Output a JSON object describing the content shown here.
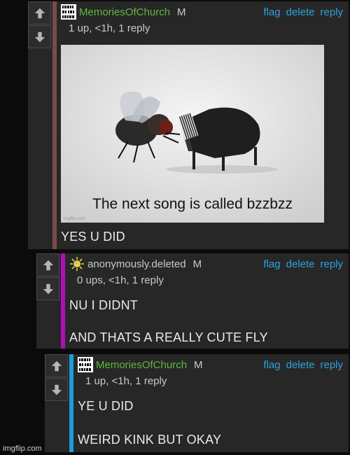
{
  "actions": {
    "flag": "flag",
    "delete": "delete",
    "reply": "reply"
  },
  "comments": [
    {
      "username": "MemoriesOfChurch",
      "badge": "M",
      "avatar_icon": "binary-pixel-icon",
      "meta": "1 up, <1h, 1 reply",
      "image": {
        "caption": "The next song is called bzzbzz",
        "watermark": "imgflip.com"
      },
      "lines": [
        "YES U DID"
      ],
      "bar_color": "#7a4a4e"
    },
    {
      "username": "anonymously.deleted",
      "badge": "M",
      "avatar_icon": "sun-icon",
      "meta": "0 ups, <1h, 1 reply",
      "lines": [
        "NU I DIDNT",
        "AND THATS A REALLY CUTE FLY"
      ],
      "bar_color": "#b00fb8"
    },
    {
      "username": "MemoriesOfChurch",
      "badge": "M",
      "avatar_icon": "binary-pixel-icon",
      "meta": "1 up, <1h, 1 reply",
      "lines": [
        "YE U DID",
        "WEIRD KINK BUT OKAY"
      ],
      "bar_color": "#1a9fd6"
    }
  ],
  "watermark": "imgflip.com"
}
